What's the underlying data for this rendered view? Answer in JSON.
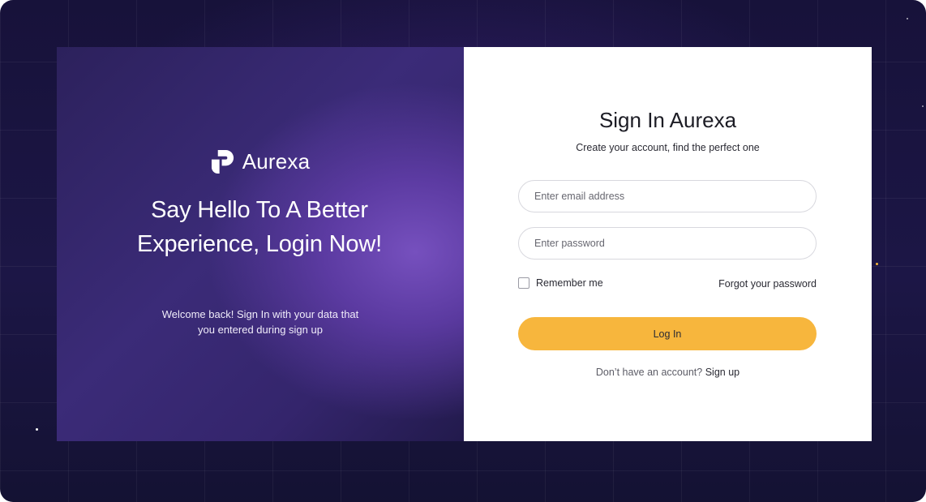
{
  "brand": {
    "name": "Aurexa",
    "logo_icon": "aurexa-logo-icon",
    "colors": {
      "accent": "#f7b63d",
      "panel_purple": "#3b2b78",
      "glow": "#7650be"
    }
  },
  "hero": {
    "headline": "Say Hello To A Better Experience, Login Now!",
    "welcome": "Welcome back! Sign In with your data that you entered during sign up"
  },
  "form": {
    "title": "Sign In Aurexa",
    "subtitle": "Create your account, find the perfect one",
    "email_placeholder": "Enter email address",
    "email_value": "",
    "password_placeholder": "Enter password",
    "password_value": "",
    "remember_label": "Remember me",
    "remember_checked": false,
    "forgot_label": "Forgot your password",
    "login_label": "Log In",
    "no_account_text": "Don’t have an account?",
    "signup_label": "Sign up"
  }
}
